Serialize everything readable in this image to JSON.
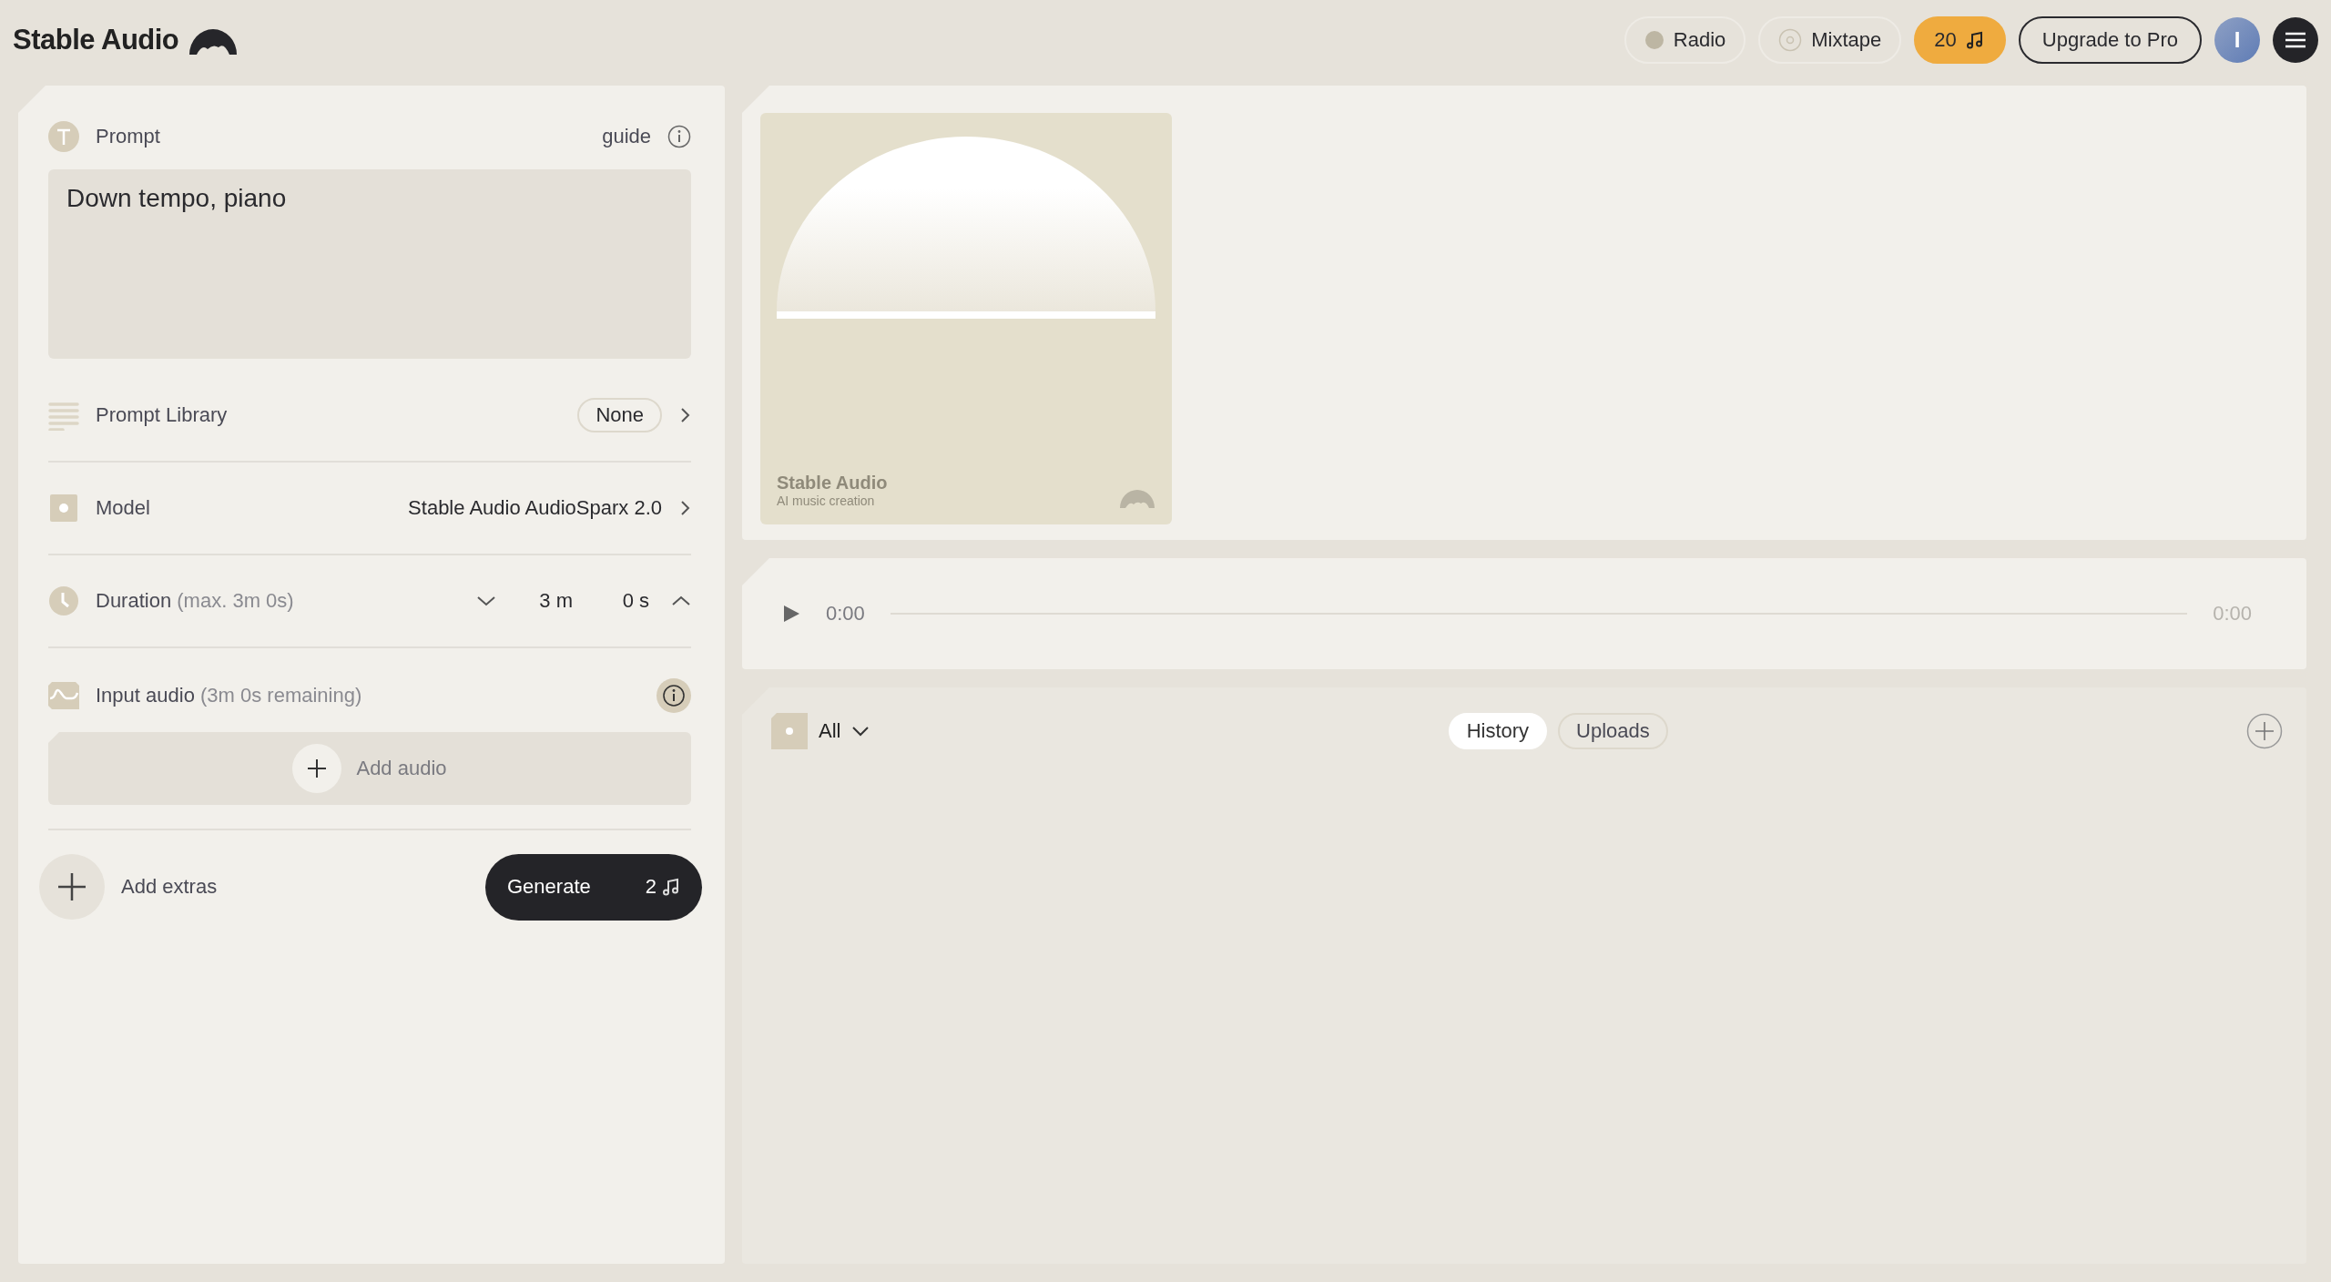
{
  "header": {
    "logo": "Stable Audio",
    "nav": [
      {
        "label": "Radio",
        "kind": "radio",
        "selected": false
      },
      {
        "label": "Mixtape",
        "kind": "mixtape",
        "selected": false
      }
    ],
    "credits": "20",
    "upgrade": "Upgrade to Pro",
    "avatar": "I"
  },
  "prompt": {
    "label": "Prompt",
    "guide": "guide",
    "value": "Down tempo, piano"
  },
  "prompt_library": {
    "label": "Prompt Library",
    "value": "None"
  },
  "model": {
    "label": "Model",
    "value": "Stable Audio AudioSparx 2.0"
  },
  "duration": {
    "label": "Duration",
    "hint": "(max. 3m 0s)",
    "minutes": "3 m",
    "seconds": "0 s"
  },
  "input_audio": {
    "label": "Input audio",
    "hint": "(3m 0s remaining)",
    "button": "Add audio"
  },
  "extras": {
    "label": "Add extras"
  },
  "generate": {
    "label": "Generate",
    "cost": "2"
  },
  "artwork": {
    "title": "Stable Audio",
    "subtitle": "AI music creation"
  },
  "player": {
    "current": "0:00",
    "total": "0:00"
  },
  "library": {
    "filter": "All",
    "tabs": [
      {
        "label": "History",
        "selected": true
      },
      {
        "label": "Uploads",
        "selected": false
      }
    ]
  }
}
